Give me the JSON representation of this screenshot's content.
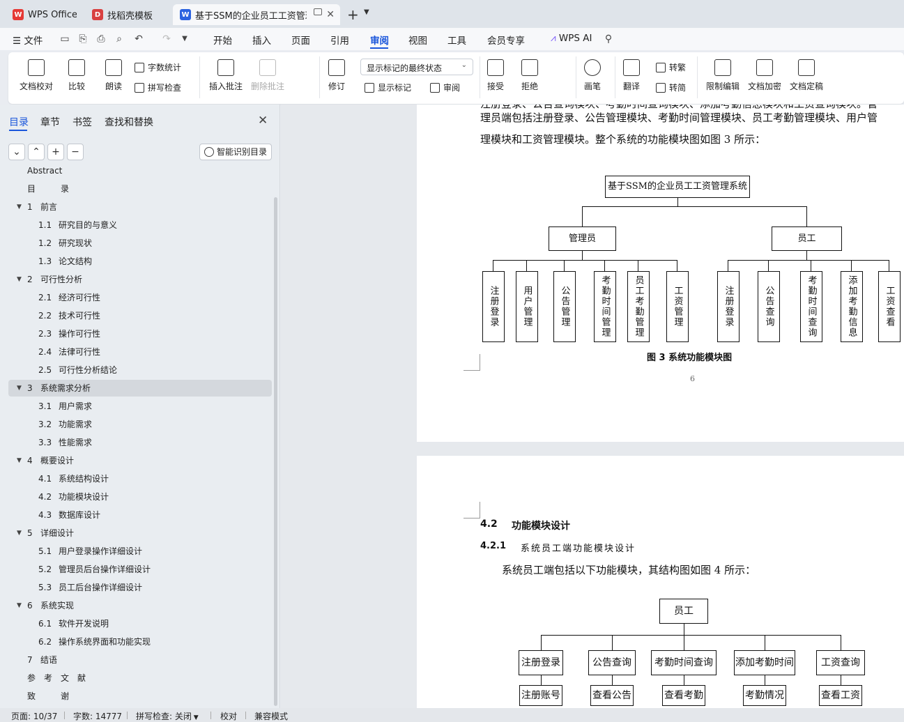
{
  "tabs": [
    {
      "label": "WPS Office",
      "icon": "wps-logo-icon"
    },
    {
      "label": "找稻壳模板",
      "icon": "docer-icon"
    },
    {
      "label": "基于SSM的企业员工工资管理",
      "icon": "writer-doc-icon"
    }
  ],
  "menu": {
    "file": "文件",
    "items": [
      "开始",
      "插入",
      "页面",
      "引用",
      "审阅",
      "视图",
      "工具",
      "会员专享"
    ],
    "active": "审阅",
    "ai": "WPS AI"
  },
  "ribbon": {
    "doc_check": "文档校对",
    "compare": "比较",
    "read_aloud": "朗读",
    "word_count": "字数统计",
    "spell_check": "拼写检查",
    "insert_comment": "插入批注",
    "delete_comment": "删除批注",
    "revise": "修订",
    "markup_state": "显示标记的最终状态",
    "show_markup": "显示标记",
    "review": "审阅",
    "accept": "接受",
    "reject": "拒绝",
    "pen": "画笔",
    "translate": "翻译",
    "to_traditional": "转繁",
    "to_simplified": "转简",
    "restrict_edit": "限制编辑",
    "encrypt": "文档加密",
    "finalize": "文档定稿"
  },
  "nav": {
    "tabs": [
      "目录",
      "章节",
      "书签",
      "查找和替换"
    ],
    "active_tab": "目录",
    "smart_toc": "智能识别目录",
    "toc": [
      {
        "num": "",
        "title": "Abstract",
        "level": 0
      },
      {
        "num": "",
        "title": "目　　　录",
        "level": 0
      },
      {
        "num": "1",
        "title": "前言",
        "level": 1
      },
      {
        "num": "1.1",
        "title": "研究目的与意义",
        "level": 2
      },
      {
        "num": "1.2",
        "title": "研究现状",
        "level": 2
      },
      {
        "num": "1.3",
        "title": "论文结构",
        "level": 2
      },
      {
        "num": "2",
        "title": "可行性分析",
        "level": 1
      },
      {
        "num": "2.1",
        "title": "经济可行性",
        "level": 2
      },
      {
        "num": "2.2",
        "title": "技术可行性",
        "level": 2
      },
      {
        "num": "2.3",
        "title": "操作可行性",
        "level": 2
      },
      {
        "num": "2.4",
        "title": "法律可行性",
        "level": 2
      },
      {
        "num": "2.5",
        "title": "可行性分析结论",
        "level": 2
      },
      {
        "num": "3",
        "title": "系统需求分析",
        "level": 1,
        "selected": true
      },
      {
        "num": "3.1",
        "title": "用户需求",
        "level": 2
      },
      {
        "num": "3.2",
        "title": "功能需求",
        "level": 2
      },
      {
        "num": "3.3",
        "title": "性能需求",
        "level": 2
      },
      {
        "num": "4",
        "title": "概要设计",
        "level": 1
      },
      {
        "num": "4.1",
        "title": "系统结构设计",
        "level": 2
      },
      {
        "num": "4.2",
        "title": "功能模块设计",
        "level": 2
      },
      {
        "num": "4.3",
        "title": "数据库设计",
        "level": 2
      },
      {
        "num": "5",
        "title": "详细设计",
        "level": 1
      },
      {
        "num": "5.1",
        "title": "用户登录操作详细设计",
        "level": 2
      },
      {
        "num": "5.2",
        "title": "管理员后台操作详细设计",
        "level": 2
      },
      {
        "num": "5.3",
        "title": "员工后台操作详细设计",
        "level": 2
      },
      {
        "num": "6",
        "title": "系统实现",
        "level": 1
      },
      {
        "num": "6.1",
        "title": "软件开发说明",
        "level": 2
      },
      {
        "num": "6.2",
        "title": "操作系统界面和功能实现",
        "level": 2
      },
      {
        "num": "7",
        "title": "结语",
        "level": 0
      },
      {
        "num": "",
        "title": "参　考　文　献",
        "level": 0
      },
      {
        "num": "",
        "title": "致　　　谢",
        "level": 0
      }
    ]
  },
  "doc": {
    "page1": {
      "line0": "注册登录、公告查询模块、考勤时间查询模块、添加考勤信息模块和工资查询模块。管",
      "line1": "理员端包括注册登录、公告管理模块、考勤时间管理模块、员工考勤管理模块、用户管",
      "line2": "理模块和工资管理模块。整个系统的功能模块图如图 3 所示：",
      "chart": {
        "root": "基于SSM的企业员工工资管理系统",
        "admin": "管理员",
        "employee": "员工",
        "admin_children": [
          "注册登录",
          "用户管理",
          "公告管理",
          "考勤时间管理",
          "员工考勤管理",
          "工资管理"
        ],
        "employee_children": [
          "注册登录",
          "公告查询",
          "考勤时间查询",
          "添加考勤信息",
          "工资查看"
        ]
      },
      "caption": "图 3  系统功能模块图",
      "page_number": "6"
    },
    "page2": {
      "h2_num": "4.2",
      "h2_title": "功能模块设计",
      "h3_num": "4.2.1",
      "h3_title": "系统员工端功能模块设计",
      "para": "系统员工端包括以下功能模块，其结构图如图 4 所示：",
      "chart": {
        "root": "员工",
        "children": [
          "注册登录",
          "公告查询",
          "考勤时间查询",
          "添加考勤时间",
          "工资查询"
        ],
        "grandchildren": [
          "注册账号",
          "查看公告",
          "查看考勤",
          "考勤情况",
          "查看工资"
        ]
      }
    }
  },
  "status": {
    "page": "页面: 10/37",
    "words": "字数: 14777",
    "spell": "拼写检查: 关闭",
    "proof": "校对",
    "compat": "兼容模式"
  }
}
